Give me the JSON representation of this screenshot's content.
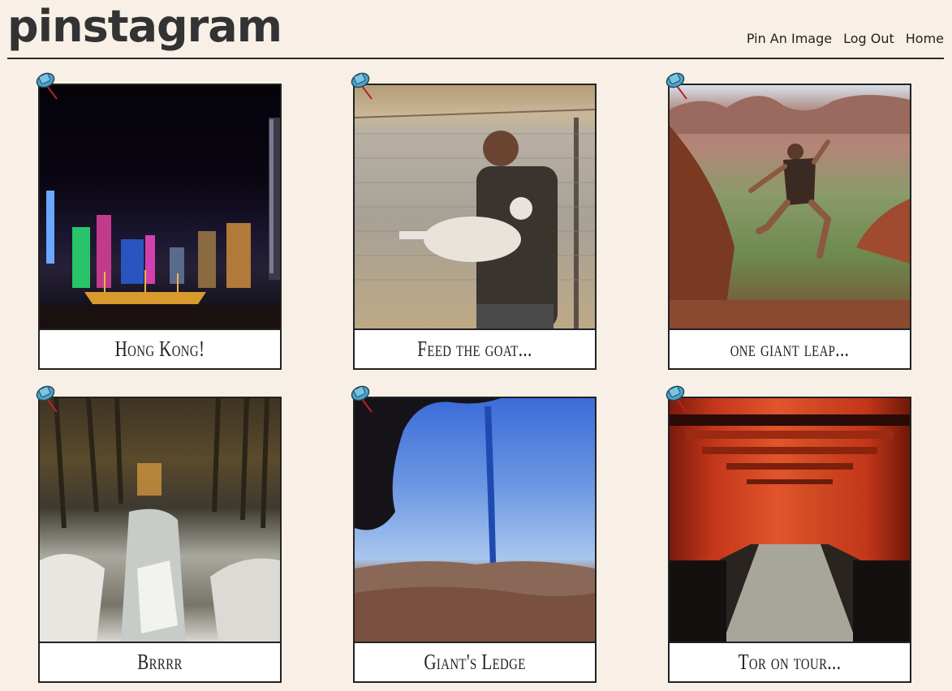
{
  "header": {
    "logo": "pinstagram",
    "nav": [
      "Pin An Image",
      "Log Out",
      "Home"
    ]
  },
  "pins": [
    {
      "caption": "Hong Kong!",
      "photo": "night-city-skyline"
    },
    {
      "caption": "Feed the goat...",
      "photo": "man-holding-goat"
    },
    {
      "caption": "one giant leap...",
      "photo": "man-jumping-canyon"
    },
    {
      "caption": "Brrrr",
      "photo": "frozen-waterfall-forest"
    },
    {
      "caption": "Giant's Ledge",
      "photo": "icicle-mountain-view"
    },
    {
      "caption": "Tor on tour...",
      "photo": "torii-gate-tunnel"
    }
  ],
  "colors": {
    "background": "#f8f0e6",
    "border": "#222222",
    "pin": "#4fa3c9"
  },
  "icons": {
    "pin": "pushpin-icon"
  }
}
